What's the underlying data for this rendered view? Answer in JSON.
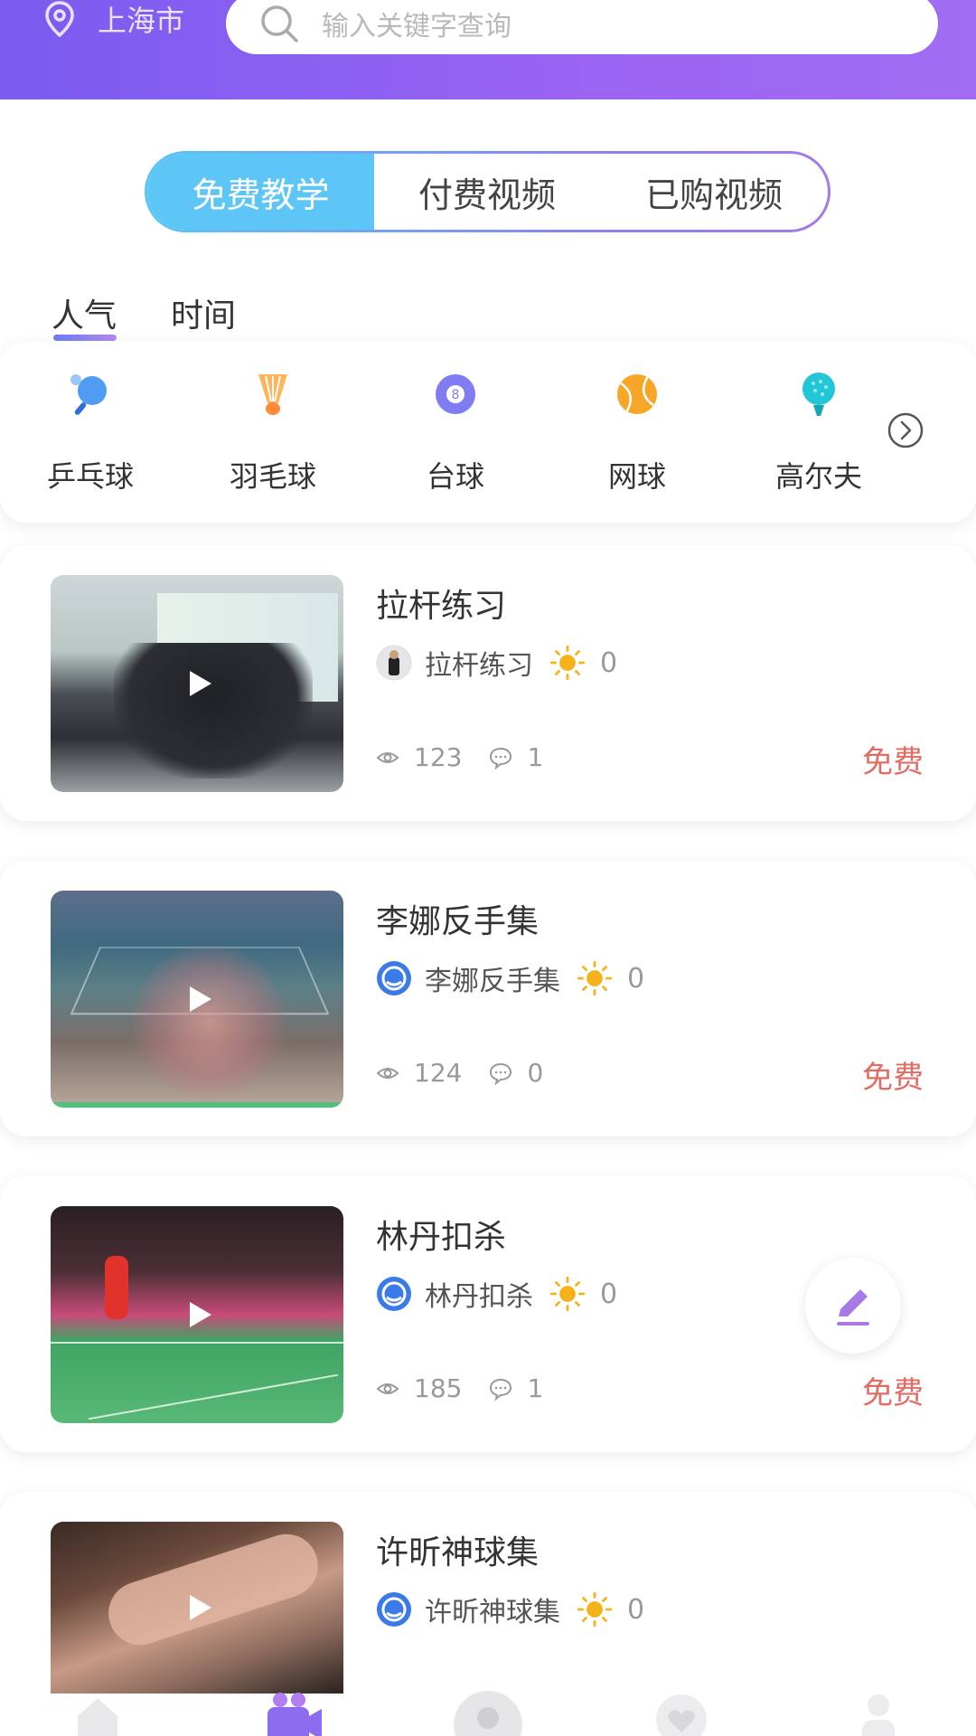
{
  "header": {
    "location": "上海市",
    "search_placeholder": "输入关键字查询"
  },
  "segments": [
    "免费教学",
    "付费视频",
    "已购视频"
  ],
  "sort_tabs": [
    "人气",
    "时间"
  ],
  "categories": [
    {
      "label": "乒乓球",
      "icon": "ping-pong-icon"
    },
    {
      "label": "羽毛球",
      "icon": "shuttlecock-icon"
    },
    {
      "label": "台球",
      "icon": "billiard-ball-icon"
    },
    {
      "label": "网球",
      "icon": "tennis-ball-icon"
    },
    {
      "label": "高尔夫",
      "icon": "golf-ball-icon"
    }
  ],
  "videos": [
    {
      "title": "拉杆练习",
      "author": "拉杆练习",
      "likes": "0",
      "views": "123",
      "comments": "1",
      "price": "免费"
    },
    {
      "title": "李娜反手集",
      "author": "李娜反手集",
      "likes": "0",
      "views": "124",
      "comments": "0",
      "price": "免费"
    },
    {
      "title": "林丹扣杀",
      "author": "林丹扣杀",
      "likes": "0",
      "views": "185",
      "comments": "1",
      "price": "免费"
    },
    {
      "title": "许昕神球集",
      "author": "许昕神球集",
      "likes": "0"
    }
  ],
  "colors": {
    "header_gradient_start": "#7a5cf0",
    "segment_active": "#5ec6f7",
    "price": "#e26b63",
    "sun": "#f6b21b",
    "fab_pencil": "#a77ae8"
  }
}
